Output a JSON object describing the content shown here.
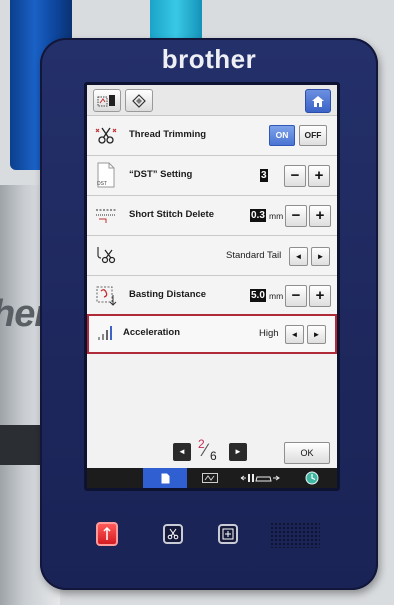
{
  "device": {
    "brand": "brother"
  },
  "settings": [
    {
      "label": "Thread Trimming",
      "on_label": "ON",
      "off_label": "OFF",
      "state": "ON"
    },
    {
      "label": "“DST” Setting",
      "value": "3",
      "minus": "−",
      "plus": "+",
      "icon_text": "DST"
    },
    {
      "label": "Short Stitch Delete",
      "value": "0.3",
      "unit": "mm",
      "minus": "−",
      "plus": "+"
    },
    {
      "label": "",
      "value": "Standard Tail",
      "left": "◄",
      "right": "►"
    },
    {
      "label": "Basting Distance",
      "value": "5.0",
      "unit": "mm",
      "minus": "−",
      "plus": "+"
    },
    {
      "label": "Acceleration",
      "value": "High",
      "left": "◄",
      "right": "►"
    }
  ],
  "pager": {
    "current": "2",
    "total": "6",
    "prev": "◄",
    "next": "►"
  },
  "ok_label": "OK",
  "colors": {
    "accent": "#4a74d3",
    "highlight_border": "#b02b3a",
    "device_body": "#1d275c",
    "start_button": "#d41b22"
  },
  "icons": [
    "embroidery-frame-icon",
    "pattern-icon",
    "home-icon",
    "scissors-icon",
    "file-icon",
    "short-stitch-icon",
    "tail-scissors-icon",
    "basting-icon",
    "acceleration-icon",
    "page-tab-icon",
    "embroidery-tab-icon",
    "carriage-tab-icon",
    "clock-icon",
    "needle-position-icon"
  ]
}
